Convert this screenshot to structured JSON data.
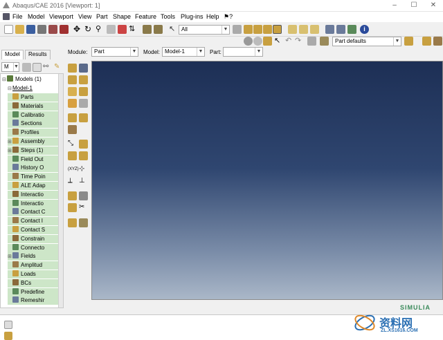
{
  "window": {
    "title": "Abaqus/CAE 2016 [Viewport: 1]",
    "min_glyph": "–",
    "max_glyph": "☐",
    "close_glyph": "✕"
  },
  "menu": [
    "File",
    "Model",
    "Viewport",
    "View",
    "Part",
    "Shape",
    "Feature",
    "Tools",
    "Plug-ins",
    "Help",
    "⚑?"
  ],
  "toolbar": {
    "select_filter": "All",
    "render_style": "Part defaults"
  },
  "context": {
    "module_label": "Module:",
    "module_value": "Part",
    "model_label": "Model:",
    "model_value": "Model-1",
    "part_label": "Part:",
    "part_value": ""
  },
  "tabs": [
    {
      "label": "Model",
      "active": true
    },
    {
      "label": "Results",
      "active": false
    }
  ],
  "tree_toolbar": {
    "dropdown_value": "M"
  },
  "tree": {
    "root": "Models (1)",
    "model": "Model-1",
    "items": [
      {
        "label": "Parts",
        "expandable": false
      },
      {
        "label": "Materials",
        "expandable": false
      },
      {
        "label": "Calibratio",
        "expandable": false
      },
      {
        "label": "Sections",
        "expandable": false
      },
      {
        "label": "Profiles",
        "expandable": false
      },
      {
        "label": "Assembly",
        "expandable": true
      },
      {
        "label": "Steps (1)",
        "expandable": true
      },
      {
        "label": "Field Out",
        "expandable": false
      },
      {
        "label": "History O",
        "expandable": false
      },
      {
        "label": "Time Poin",
        "expandable": false
      },
      {
        "label": "ALE Adap",
        "expandable": false
      },
      {
        "label": "Interactio",
        "expandable": false
      },
      {
        "label": "Interactio",
        "expandable": false
      },
      {
        "label": "Contact C",
        "expandable": false
      },
      {
        "label": "Contact I",
        "expandable": false
      },
      {
        "label": "Contact S",
        "expandable": false
      },
      {
        "label": "Constrain",
        "expandable": false
      },
      {
        "label": "Connecto",
        "expandable": false
      },
      {
        "label": "Fields",
        "expandable": true
      },
      {
        "label": "Amplitud",
        "expandable": false
      },
      {
        "label": "Loads",
        "expandable": false
      },
      {
        "label": "BCs",
        "expandable": false
      },
      {
        "label": "Predefine",
        "expandable": false
      },
      {
        "label": "Remeshir",
        "expandable": false
      }
    ]
  },
  "viewport": {
    "logo_text": "SIMULIA"
  },
  "watermark": {
    "brand": "资料网",
    "url": "ZL.XS1616.COM"
  },
  "colors": {
    "accent": "#c8a040",
    "tree_highlight": "#cde6c8",
    "viewport_top": "#1d2f55",
    "viewport_bottom": "#aab7c8"
  }
}
